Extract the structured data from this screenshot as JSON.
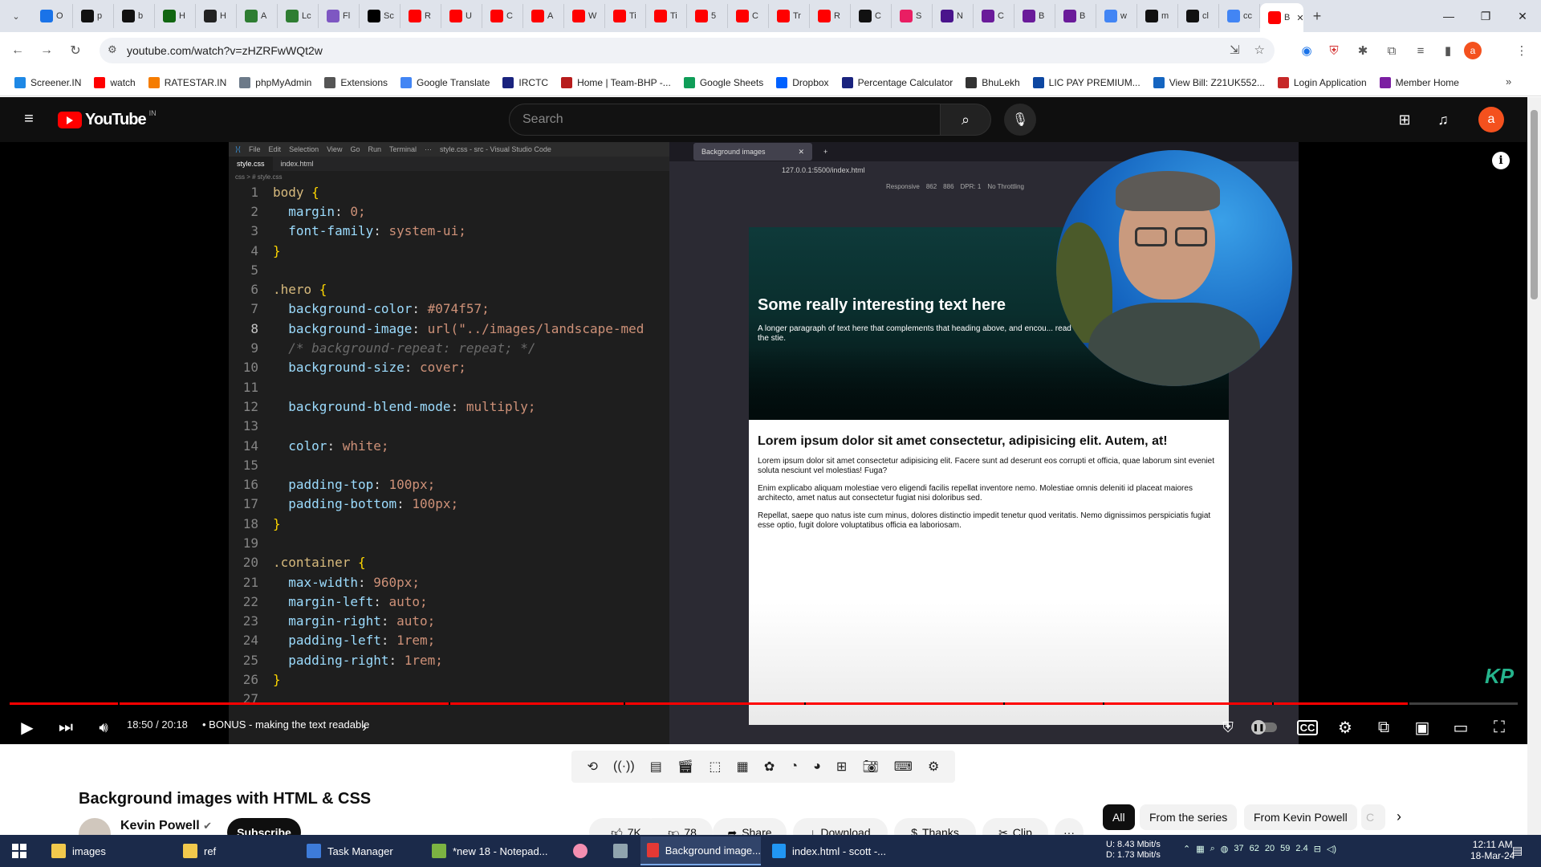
{
  "browser": {
    "tabs": [
      {
        "label": "O",
        "favicon": "chrome-icon",
        "color": "#1a73e8"
      },
      {
        "label": "p",
        "favicon": "medium-icon",
        "color": "#111111"
      },
      {
        "label": "b",
        "favicon": "medium-icon",
        "color": "#111111"
      },
      {
        "label": "H",
        "favicon": "wix-icon",
        "color": "#116611"
      },
      {
        "label": "H",
        "favicon": "hashnode-icon",
        "color": "#222222"
      },
      {
        "label": "A",
        "favicon": "arrow-icon",
        "color": "#2e7d32"
      },
      {
        "label": "Lc",
        "favicon": "shield-icon",
        "color": "#2e7d32"
      },
      {
        "label": "Fl",
        "favicon": "swirl-icon",
        "color": "#7e57c2"
      },
      {
        "label": "Sc",
        "favicon": "scribd-icon",
        "color": "#000000"
      },
      {
        "label": "R",
        "favicon": "youtube-icon",
        "color": "#ff0000"
      },
      {
        "label": "U",
        "favicon": "youtube-icon",
        "color": "#ff0000"
      },
      {
        "label": "C",
        "favicon": "youtube-icon",
        "color": "#ff0000"
      },
      {
        "label": "A",
        "favicon": "youtube-icon",
        "color": "#ff0000"
      },
      {
        "label": "W",
        "favicon": "youtube-icon",
        "color": "#ff0000"
      },
      {
        "label": "Ti",
        "favicon": "youtube-icon",
        "color": "#ff0000"
      },
      {
        "label": "Ti",
        "favicon": "youtube-icon",
        "color": "#ff0000"
      },
      {
        "label": "5",
        "favicon": "youtube-icon",
        "color": "#ff0000"
      },
      {
        "label": "C",
        "favicon": "youtube-icon",
        "color": "#ff0000"
      },
      {
        "label": "Tr",
        "favicon": "youtube-icon",
        "color": "#ff0000"
      },
      {
        "label": "R",
        "favicon": "youtube-icon",
        "color": "#ff0000"
      },
      {
        "label": "C",
        "favicon": "chatgpt-icon",
        "color": "#111111"
      },
      {
        "label": "S",
        "favicon": "s-icon",
        "color": "#e91e63"
      },
      {
        "label": "N",
        "favicon": "obsidian-icon",
        "color": "#4a148c"
      },
      {
        "label": "C",
        "favicon": "b-icon",
        "color": "#6a1b9a"
      },
      {
        "label": "B",
        "favicon": "b-icon",
        "color": "#6a1b9a"
      },
      {
        "label": "B",
        "favicon": "b-icon",
        "color": "#6a1b9a"
      },
      {
        "label": "w",
        "favicon": "google-icon",
        "color": "#4285f4"
      },
      {
        "label": "m",
        "favicon": "medium-icon",
        "color": "#111111"
      },
      {
        "label": "cl",
        "favicon": "medium-icon",
        "color": "#111111"
      },
      {
        "label": "cc",
        "favicon": "google-icon",
        "color": "#4285f4"
      }
    ],
    "active_tab": {
      "label": "B",
      "favicon": "youtube-icon",
      "color": "#ff0000"
    },
    "url": "youtube.com/watch?v=zHZRFwWQt2w",
    "bookmarks": [
      {
        "label": "Screener.IN",
        "color": "#1e88e5"
      },
      {
        "label": "watch",
        "color": "#ff0000"
      },
      {
        "label": "RATESTAR.IN",
        "color": "#f57c00"
      },
      {
        "label": "phpMyAdmin",
        "color": "#6c7a89"
      },
      {
        "label": "Extensions",
        "color": "#555555"
      },
      {
        "label": "Google Translate",
        "color": "#4285f4"
      },
      {
        "label": "IRCTC",
        "color": "#1a237e"
      },
      {
        "label": "Home | Team-BHP -...",
        "color": "#b71c1c"
      },
      {
        "label": "Google Sheets",
        "color": "#0f9d58"
      },
      {
        "label": "Dropbox",
        "color": "#0061ff"
      },
      {
        "label": "Percentage Calculator",
        "color": "#1a237e"
      },
      {
        "label": "BhuLekh",
        "color": "#333333"
      },
      {
        "label": "LIC PAY PREMIUM...",
        "color": "#0d47a1"
      },
      {
        "label": "View Bill: Z21UK552...",
        "color": "#1565c0"
      },
      {
        "label": "Login Application",
        "color": "#c62828"
      },
      {
        "label": "Member Home",
        "color": "#7b1fa2"
      }
    ]
  },
  "youtube": {
    "logo": "YouTube",
    "country": "IN",
    "search_placeholder": "Search",
    "avatar_letter": "a",
    "brand_color": "#ff0000"
  },
  "video_frame": {
    "vscode_title": "style.css - src - Visual Studio Code",
    "vscode_menu": [
      "File",
      "Edit",
      "Selection",
      "View",
      "Go",
      "Run",
      "Terminal",
      "···"
    ],
    "vscode_tabs": [
      "style.css",
      "index.html"
    ],
    "breadcrumb": "css > # style.css",
    "code_lines": [
      {
        "n": "1",
        "t": "body {"
      },
      {
        "n": "2",
        "t": "  margin: 0;"
      },
      {
        "n": "3",
        "t": "  font-family: system-ui;"
      },
      {
        "n": "4",
        "t": "}"
      },
      {
        "n": "5",
        "t": ""
      },
      {
        "n": "6",
        "t": ".hero {"
      },
      {
        "n": "7",
        "t": "  background-color: #074f57;"
      },
      {
        "n": "8",
        "t": "  background-image: url(\"../images/landscape-med"
      },
      {
        "n": "9",
        "t": "  /* background-repeat: repeat; */"
      },
      {
        "n": "10",
        "t": "  background-size: cover;"
      },
      {
        "n": "11",
        "t": ""
      },
      {
        "n": "12",
        "t": "  background-blend-mode: multiply;"
      },
      {
        "n": "13",
        "t": ""
      },
      {
        "n": "14",
        "t": "  color: white;"
      },
      {
        "n": "15",
        "t": ""
      },
      {
        "n": "16",
        "t": "  padding-top: 100px;"
      },
      {
        "n": "17",
        "t": "  padding-bottom: 100px;"
      },
      {
        "n": "18",
        "t": "}"
      },
      {
        "n": "19",
        "t": ""
      },
      {
        "n": "20",
        "t": ".container {"
      },
      {
        "n": "21",
        "t": "  max-width: 960px;"
      },
      {
        "n": "22",
        "t": "  margin-left: auto;"
      },
      {
        "n": "23",
        "t": "  margin-right: auto;"
      },
      {
        "n": "24",
        "t": "  padding-left: 1rem;"
      },
      {
        "n": "25",
        "t": "  padding-right: 1rem;"
      },
      {
        "n": "26",
        "t": "}"
      },
      {
        "n": "27",
        "t": ""
      }
    ],
    "browser_tab": "Background images",
    "browser_url": "127.0.0.1:5500/index.html",
    "responsive": "Responsive",
    "width": "862",
    "height": "886",
    "dpr": "DPR: 1",
    "throttle": "No Throttling",
    "hero_heading": "Some really interesting text here",
    "hero_paragraph": "A longer paragraph of text here that complements that heading above, and encou... read of the stie.",
    "section_heading": "Lorem ipsum dolor sit amet consectetur, adipisicing elit. Autem, at!",
    "paragraphs": [
      "Lorem ipsum dolor sit amet consectetur adipisicing elit. Facere sunt ad deserunt eos corrupti et officia, quae laborum sint eveniet soluta nesciunt vel molestias! Fuga?",
      "Enim explicabo aliquam molestiae vero eligendi facilis repellat inventore nemo. Molestiae omnis deleniti id placeat maiores architecto, amet natus aut consectetur fugiat nisi doloribus sed.",
      "Repellat, saepe quo natus iste cum minus, dolores distinctio impedit tenetur quod veritatis. Nemo dignissimos perspiciatis fugiat esse optio, fugit dolore voluptatibus officia ea laboriosam."
    ],
    "watermark": "KP"
  },
  "player": {
    "time": "18:50 / 20:18",
    "chapter": "• BONUS - making the text readable",
    "progress_fraction": 0.927,
    "chapter_marks": [
      0.072,
      0.291,
      0.407,
      0.527,
      0.659,
      0.725,
      0.837,
      0.927
    ]
  },
  "extension_toolbar": [
    "loop-icon",
    "audio-icon",
    "screenshot-icon",
    "cinema-icon",
    "crop-icon",
    "film-icon",
    "filter-icon",
    "speed-icon",
    "speed-plus-icon",
    "frame-icon",
    "camera-icon",
    "keyboard-icon",
    "gear-icon"
  ],
  "video": {
    "title": "Background images with HTML & CSS",
    "channel": "Kevin Powell",
    "subscribe": "Subscribe",
    "likes": "7K",
    "dislikes": "78",
    "share": "Share",
    "download": "Download",
    "thanks": "Thanks",
    "clip": "Clip",
    "more": "···"
  },
  "chips": [
    "All",
    "From the series",
    "From Kevin Powell",
    "C"
  ],
  "taskbar": {
    "items": [
      {
        "label": "images",
        "color": "#f2c94c"
      },
      {
        "label": "ref",
        "color": "#f2c94c"
      },
      {
        "label": "Task Manager",
        "color": "#3d7bd9"
      },
      {
        "label": "*new 18 - Notepad...",
        "color": "#7cb342"
      },
      {
        "label": "Background image...",
        "color": "#e53935"
      },
      {
        "label": "index.html - scott -...",
        "color": "#2196f3"
      }
    ],
    "net_up": "U:   8.43 Mbit/s",
    "net_down": "D:   1.73 Mbit/s",
    "tray_numbers": [
      "37",
      "62",
      "20",
      "59",
      "2.4"
    ],
    "time": "12:11 AM",
    "date": "18-Mar-24"
  }
}
